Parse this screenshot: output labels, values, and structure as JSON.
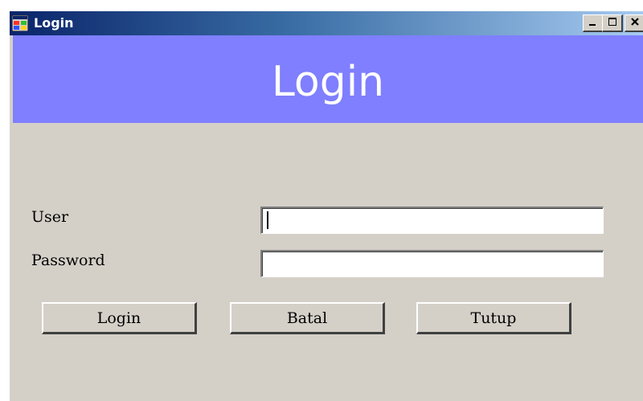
{
  "window": {
    "title": "Login",
    "title_icon": "app-window-icon",
    "controls": {
      "minimize_icon": "minimize-icon",
      "maximize_icon": "maximize-icon",
      "close_icon": "close-icon"
    }
  },
  "banner": {
    "title": "Login",
    "color": "#7f7fff"
  },
  "form": {
    "user_label": "User",
    "user_value": "",
    "password_label": "Password",
    "password_value": ""
  },
  "buttons": {
    "login": "Login",
    "batal": "Batal",
    "tutup": "Tutup"
  },
  "colors": {
    "window_bg": "#d4d0c8",
    "titlebar_start": "#0a246a",
    "titlebar_end": "#a6caf0"
  }
}
